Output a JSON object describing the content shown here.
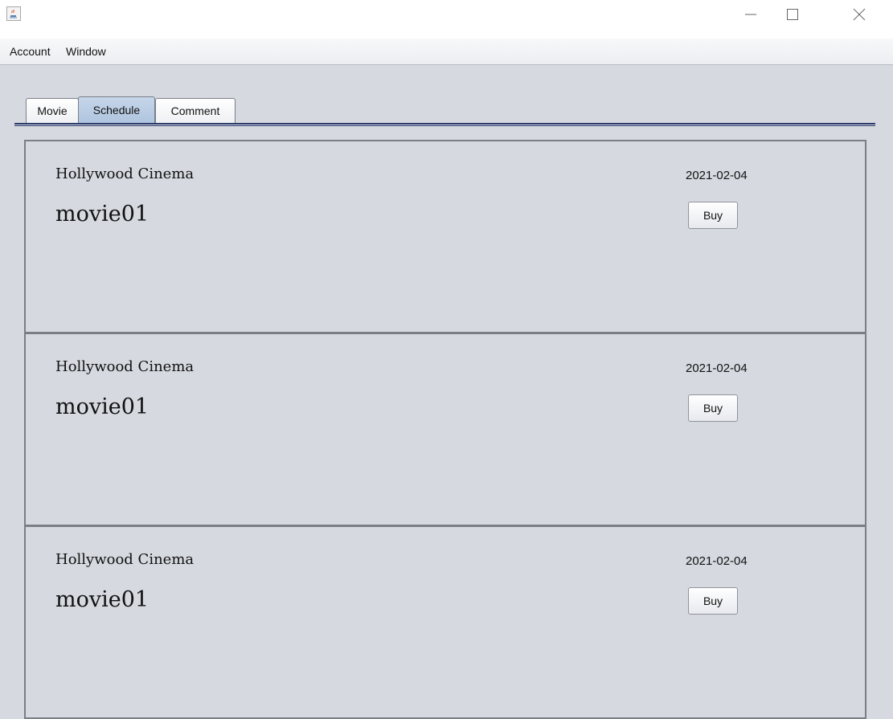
{
  "window": {
    "controls": [
      "minimize-icon",
      "maximize-icon",
      "close-icon"
    ]
  },
  "menu": {
    "items": [
      "Account",
      "Window"
    ]
  },
  "tabs": [
    {
      "label": "Movie",
      "active": false
    },
    {
      "label": "Schedule",
      "active": true
    },
    {
      "label": "Comment",
      "active": false
    }
  ],
  "schedules": [
    {
      "cinema": "Hollywood Cinema",
      "movie": "movie01",
      "date": "2021-02-04",
      "action": "Buy"
    },
    {
      "cinema": "Hollywood Cinema",
      "movie": "movie01",
      "date": "2021-02-04",
      "action": "Buy"
    },
    {
      "cinema": "Hollywood Cinema",
      "movie": "movie01",
      "date": "2021-02-04",
      "action": "Buy"
    }
  ]
}
